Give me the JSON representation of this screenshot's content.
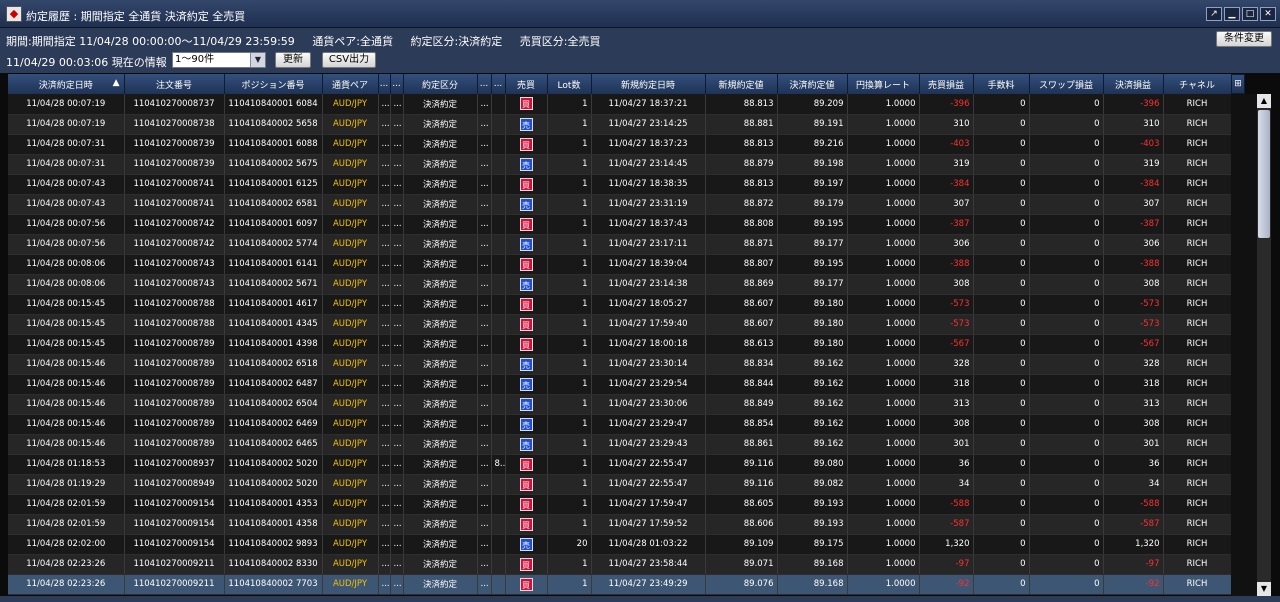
{
  "window": {
    "title": "約定履歴 : 期間指定 全通貨 決済約定 全売買"
  },
  "info": {
    "period": "期間:期間指定 11/04/28 00:00:00～11/04/29 23:59:59",
    "pair": "通貨ペア:全通貨",
    "contract_type": "約定区分:決済約定",
    "side": "売買区分:全売買",
    "current_info": "11/04/29 00:03:06 現在の情報",
    "select_value": "1～90件",
    "update_button": "更新",
    "csv_button": "CSV出力",
    "condition_button": "条件変更"
  },
  "table": {
    "columns": [
      "決済約定日時",
      "注文番号",
      "ポジション番号",
      "通貨ペア",
      "...",
      "...",
      "約定区分",
      "...",
      "...",
      "売買",
      "Lot数",
      "新規約定日時",
      "新規約定値",
      "決済約定値",
      "円換算レート",
      "売買損益",
      "手数料",
      "スワップ損益",
      "決済損益",
      "チャネル"
    ],
    "sort_indicator": "▲",
    "rows": [
      {
        "dt": "11/04/28 00:07:19",
        "order": "110410270008737",
        "pos": "110410840001 6084",
        "pair": "AUD/JPY",
        "c5": "...",
        "c6": "...",
        "type": "決済約定",
        "c8": "...",
        "c9": "",
        "side": "買",
        "lot": "1",
        "open_dt": "11/04/27 18:37:21",
        "open": "88.813",
        "close": "89.209",
        "rate": "1.0000",
        "pl": "-396",
        "fee": "0",
        "swap": "0",
        "net": "-396",
        "ch": "RICH"
      },
      {
        "dt": "11/04/28 00:07:19",
        "order": "110410270008738",
        "pos": "110410840002 5658",
        "pair": "AUD/JPY",
        "c5": "...",
        "c6": "...",
        "type": "決済約定",
        "c8": "...",
        "c9": "",
        "side": "売",
        "lot": "1",
        "open_dt": "11/04/27 23:14:25",
        "open": "88.881",
        "close": "89.191",
        "rate": "1.0000",
        "pl": "310",
        "fee": "0",
        "swap": "0",
        "net": "310",
        "ch": "RICH"
      },
      {
        "dt": "11/04/28 00:07:31",
        "order": "110410270008739",
        "pos": "110410840001 6088",
        "pair": "AUD/JPY",
        "c5": "...",
        "c6": "...",
        "type": "決済約定",
        "c8": "...",
        "c9": "",
        "side": "買",
        "lot": "1",
        "open_dt": "11/04/27 18:37:23",
        "open": "88.813",
        "close": "89.216",
        "rate": "1.0000",
        "pl": "-403",
        "fee": "0",
        "swap": "0",
        "net": "-403",
        "ch": "RICH"
      },
      {
        "dt": "11/04/28 00:07:31",
        "order": "110410270008739",
        "pos": "110410840002 5675",
        "pair": "AUD/JPY",
        "c5": "...",
        "c6": "...",
        "type": "決済約定",
        "c8": "...",
        "c9": "",
        "side": "売",
        "lot": "1",
        "open_dt": "11/04/27 23:14:45",
        "open": "88.879",
        "close": "89.198",
        "rate": "1.0000",
        "pl": "319",
        "fee": "0",
        "swap": "0",
        "net": "319",
        "ch": "RICH"
      },
      {
        "dt": "11/04/28 00:07:43",
        "order": "110410270008741",
        "pos": "110410840001 6125",
        "pair": "AUD/JPY",
        "c5": "...",
        "c6": "...",
        "type": "決済約定",
        "c8": "...",
        "c9": "",
        "side": "買",
        "lot": "1",
        "open_dt": "11/04/27 18:38:35",
        "open": "88.813",
        "close": "89.197",
        "rate": "1.0000",
        "pl": "-384",
        "fee": "0",
        "swap": "0",
        "net": "-384",
        "ch": "RICH"
      },
      {
        "dt": "11/04/28 00:07:43",
        "order": "110410270008741",
        "pos": "110410840002 6581",
        "pair": "AUD/JPY",
        "c5": "...",
        "c6": "...",
        "type": "決済約定",
        "c8": "...",
        "c9": "",
        "side": "売",
        "lot": "1",
        "open_dt": "11/04/27 23:31:19",
        "open": "88.872",
        "close": "89.179",
        "rate": "1.0000",
        "pl": "307",
        "fee": "0",
        "swap": "0",
        "net": "307",
        "ch": "RICH"
      },
      {
        "dt": "11/04/28 00:07:56",
        "order": "110410270008742",
        "pos": "110410840001 6097",
        "pair": "AUD/JPY",
        "c5": "...",
        "c6": "...",
        "type": "決済約定",
        "c8": "...",
        "c9": "",
        "side": "買",
        "lot": "1",
        "open_dt": "11/04/27 18:37:43",
        "open": "88.808",
        "close": "89.195",
        "rate": "1.0000",
        "pl": "-387",
        "fee": "0",
        "swap": "0",
        "net": "-387",
        "ch": "RICH"
      },
      {
        "dt": "11/04/28 00:07:56",
        "order": "110410270008742",
        "pos": "110410840002 5774",
        "pair": "AUD/JPY",
        "c5": "...",
        "c6": "...",
        "type": "決済約定",
        "c8": "...",
        "c9": "",
        "side": "売",
        "lot": "1",
        "open_dt": "11/04/27 23:17:11",
        "open": "88.871",
        "close": "89.177",
        "rate": "1.0000",
        "pl": "306",
        "fee": "0",
        "swap": "0",
        "net": "306",
        "ch": "RICH"
      },
      {
        "dt": "11/04/28 00:08:06",
        "order": "110410270008743",
        "pos": "110410840001 6141",
        "pair": "AUD/JPY",
        "c5": "...",
        "c6": "...",
        "type": "決済約定",
        "c8": "...",
        "c9": "",
        "side": "買",
        "lot": "1",
        "open_dt": "11/04/27 18:39:04",
        "open": "88.807",
        "close": "89.195",
        "rate": "1.0000",
        "pl": "-388",
        "fee": "0",
        "swap": "0",
        "net": "-388",
        "ch": "RICH"
      },
      {
        "dt": "11/04/28 00:08:06",
        "order": "110410270008743",
        "pos": "110410840002 5671",
        "pair": "AUD/JPY",
        "c5": "...",
        "c6": "...",
        "type": "決済約定",
        "c8": "...",
        "c9": "",
        "side": "売",
        "lot": "1",
        "open_dt": "11/04/27 23:14:38",
        "open": "88.869",
        "close": "89.177",
        "rate": "1.0000",
        "pl": "308",
        "fee": "0",
        "swap": "0",
        "net": "308",
        "ch": "RICH"
      },
      {
        "dt": "11/04/28 00:15:45",
        "order": "110410270008788",
        "pos": "110410840001 4617",
        "pair": "AUD/JPY",
        "c5": "...",
        "c6": "...",
        "type": "決済約定",
        "c8": "...",
        "c9": "",
        "side": "買",
        "lot": "1",
        "open_dt": "11/04/27 18:05:27",
        "open": "88.607",
        "close": "89.180",
        "rate": "1.0000",
        "pl": "-573",
        "fee": "0",
        "swap": "0",
        "net": "-573",
        "ch": "RICH"
      },
      {
        "dt": "11/04/28 00:15:45",
        "order": "110410270008788",
        "pos": "110410840001 4345",
        "pair": "AUD/JPY",
        "c5": "...",
        "c6": "...",
        "type": "決済約定",
        "c8": "...",
        "c9": "",
        "side": "買",
        "lot": "1",
        "open_dt": "11/04/27 17:59:40",
        "open": "88.607",
        "close": "89.180",
        "rate": "1.0000",
        "pl": "-573",
        "fee": "0",
        "swap": "0",
        "net": "-573",
        "ch": "RICH"
      },
      {
        "dt": "11/04/28 00:15:45",
        "order": "110410270008789",
        "pos": "110410840001 4398",
        "pair": "AUD/JPY",
        "c5": "...",
        "c6": "...",
        "type": "決済約定",
        "c8": "...",
        "c9": "",
        "side": "買",
        "lot": "1",
        "open_dt": "11/04/27 18:00:18",
        "open": "88.613",
        "close": "89.180",
        "rate": "1.0000",
        "pl": "-567",
        "fee": "0",
        "swap": "0",
        "net": "-567",
        "ch": "RICH"
      },
      {
        "dt": "11/04/28 00:15:46",
        "order": "110410270008789",
        "pos": "110410840002 6518",
        "pair": "AUD/JPY",
        "c5": "...",
        "c6": "...",
        "type": "決済約定",
        "c8": "...",
        "c9": "",
        "side": "売",
        "lot": "1",
        "open_dt": "11/04/27 23:30:14",
        "open": "88.834",
        "close": "89.162",
        "rate": "1.0000",
        "pl": "328",
        "fee": "0",
        "swap": "0",
        "net": "328",
        "ch": "RICH"
      },
      {
        "dt": "11/04/28 00:15:46",
        "order": "110410270008789",
        "pos": "110410840002 6487",
        "pair": "AUD/JPY",
        "c5": "...",
        "c6": "...",
        "type": "決済約定",
        "c8": "...",
        "c9": "",
        "side": "売",
        "lot": "1",
        "open_dt": "11/04/27 23:29:54",
        "open": "88.844",
        "close": "89.162",
        "rate": "1.0000",
        "pl": "318",
        "fee": "0",
        "swap": "0",
        "net": "318",
        "ch": "RICH"
      },
      {
        "dt": "11/04/28 00:15:46",
        "order": "110410270008789",
        "pos": "110410840002 6504",
        "pair": "AUD/JPY",
        "c5": "...",
        "c6": "...",
        "type": "決済約定",
        "c8": "...",
        "c9": "",
        "side": "売",
        "lot": "1",
        "open_dt": "11/04/27 23:30:06",
        "open": "88.849",
        "close": "89.162",
        "rate": "1.0000",
        "pl": "313",
        "fee": "0",
        "swap": "0",
        "net": "313",
        "ch": "RICH"
      },
      {
        "dt": "11/04/28 00:15:46",
        "order": "110410270008789",
        "pos": "110410840002 6469",
        "pair": "AUD/JPY",
        "c5": "...",
        "c6": "...",
        "type": "決済約定",
        "c8": "...",
        "c9": "",
        "side": "売",
        "lot": "1",
        "open_dt": "11/04/27 23:29:47",
        "open": "88.854",
        "close": "89.162",
        "rate": "1.0000",
        "pl": "308",
        "fee": "0",
        "swap": "0",
        "net": "308",
        "ch": "RICH"
      },
      {
        "dt": "11/04/28 00:15:46",
        "order": "110410270008789",
        "pos": "110410840002 6465",
        "pair": "AUD/JPY",
        "c5": "...",
        "c6": "...",
        "type": "決済約定",
        "c8": "...",
        "c9": "",
        "side": "売",
        "lot": "1",
        "open_dt": "11/04/27 23:29:43",
        "open": "88.861",
        "close": "89.162",
        "rate": "1.0000",
        "pl": "301",
        "fee": "0",
        "swap": "0",
        "net": "301",
        "ch": "RICH"
      },
      {
        "dt": "11/04/28 01:18:53",
        "order": "110410270008937",
        "pos": "110410840002 5020",
        "pair": "AUD/JPY",
        "c5": "...",
        "c6": "...",
        "type": "決済約定",
        "c8": "...",
        "c9": "8...",
        "side": "買",
        "lot": "1",
        "open_dt": "11/04/27 22:55:47",
        "open": "89.116",
        "close": "89.080",
        "rate": "1.0000",
        "pl": "36",
        "fee": "0",
        "swap": "0",
        "net": "36",
        "ch": "RICH"
      },
      {
        "dt": "11/04/28 01:19:29",
        "order": "110410270008949",
        "pos": "110410840002 5020",
        "pair": "AUD/JPY",
        "c5": "...",
        "c6": "...",
        "type": "決済約定",
        "c8": "...",
        "c9": "",
        "side": "買",
        "lot": "1",
        "open_dt": "11/04/27 22:55:47",
        "open": "89.116",
        "close": "89.082",
        "rate": "1.0000",
        "pl": "34",
        "fee": "0",
        "swap": "0",
        "net": "34",
        "ch": "RICH"
      },
      {
        "dt": "11/04/28 02:01:59",
        "order": "110410270009154",
        "pos": "110410840001 4353",
        "pair": "AUD/JPY",
        "c5": "...",
        "c6": "...",
        "type": "決済約定",
        "c8": "...",
        "c9": "",
        "side": "買",
        "lot": "1",
        "open_dt": "11/04/27 17:59:47",
        "open": "88.605",
        "close": "89.193",
        "rate": "1.0000",
        "pl": "-588",
        "fee": "0",
        "swap": "0",
        "net": "-588",
        "ch": "RICH"
      },
      {
        "dt": "11/04/28 02:01:59",
        "order": "110410270009154",
        "pos": "110410840001 4358",
        "pair": "AUD/JPY",
        "c5": "...",
        "c6": "...",
        "type": "決済約定",
        "c8": "...",
        "c9": "",
        "side": "買",
        "lot": "1",
        "open_dt": "11/04/27 17:59:52",
        "open": "88.606",
        "close": "89.193",
        "rate": "1.0000",
        "pl": "-587",
        "fee": "0",
        "swap": "0",
        "net": "-587",
        "ch": "RICH"
      },
      {
        "dt": "11/04/28 02:02:00",
        "order": "110410270009154",
        "pos": "110410840002 9893",
        "pair": "AUD/JPY",
        "c5": "...",
        "c6": "...",
        "type": "決済約定",
        "c8": "...",
        "c9": "",
        "side": "売",
        "lot": "20",
        "open_dt": "11/04/28 01:03:22",
        "open": "89.109",
        "close": "89.175",
        "rate": "1.0000",
        "pl": "1,320",
        "fee": "0",
        "swap": "0",
        "net": "1,320",
        "ch": "RICH"
      },
      {
        "dt": "11/04/28 02:23:26",
        "order": "110410270009211",
        "pos": "110410840002 8330",
        "pair": "AUD/JPY",
        "c5": "...",
        "c6": "...",
        "type": "決済約定",
        "c8": "...",
        "c9": "",
        "side": "買",
        "lot": "1",
        "open_dt": "11/04/27 23:58:44",
        "open": "89.071",
        "close": "89.168",
        "rate": "1.0000",
        "pl": "-97",
        "fee": "0",
        "swap": "0",
        "net": "-97",
        "ch": "RICH"
      },
      {
        "dt": "11/04/28 02:23:26",
        "order": "110410270009211",
        "pos": "110410840002 7703",
        "pair": "AUD/JPY",
        "c5": "...",
        "c6": "...",
        "type": "決済約定",
        "c8": "...",
        "c9": "",
        "side": "買",
        "lot": "1",
        "open_dt": "11/04/27 23:49:29",
        "open": "89.076",
        "close": "89.168",
        "rate": "1.0000",
        "pl": "-92",
        "fee": "0",
        "swap": "0",
        "net": "-92",
        "ch": "RICH"
      }
    ]
  }
}
